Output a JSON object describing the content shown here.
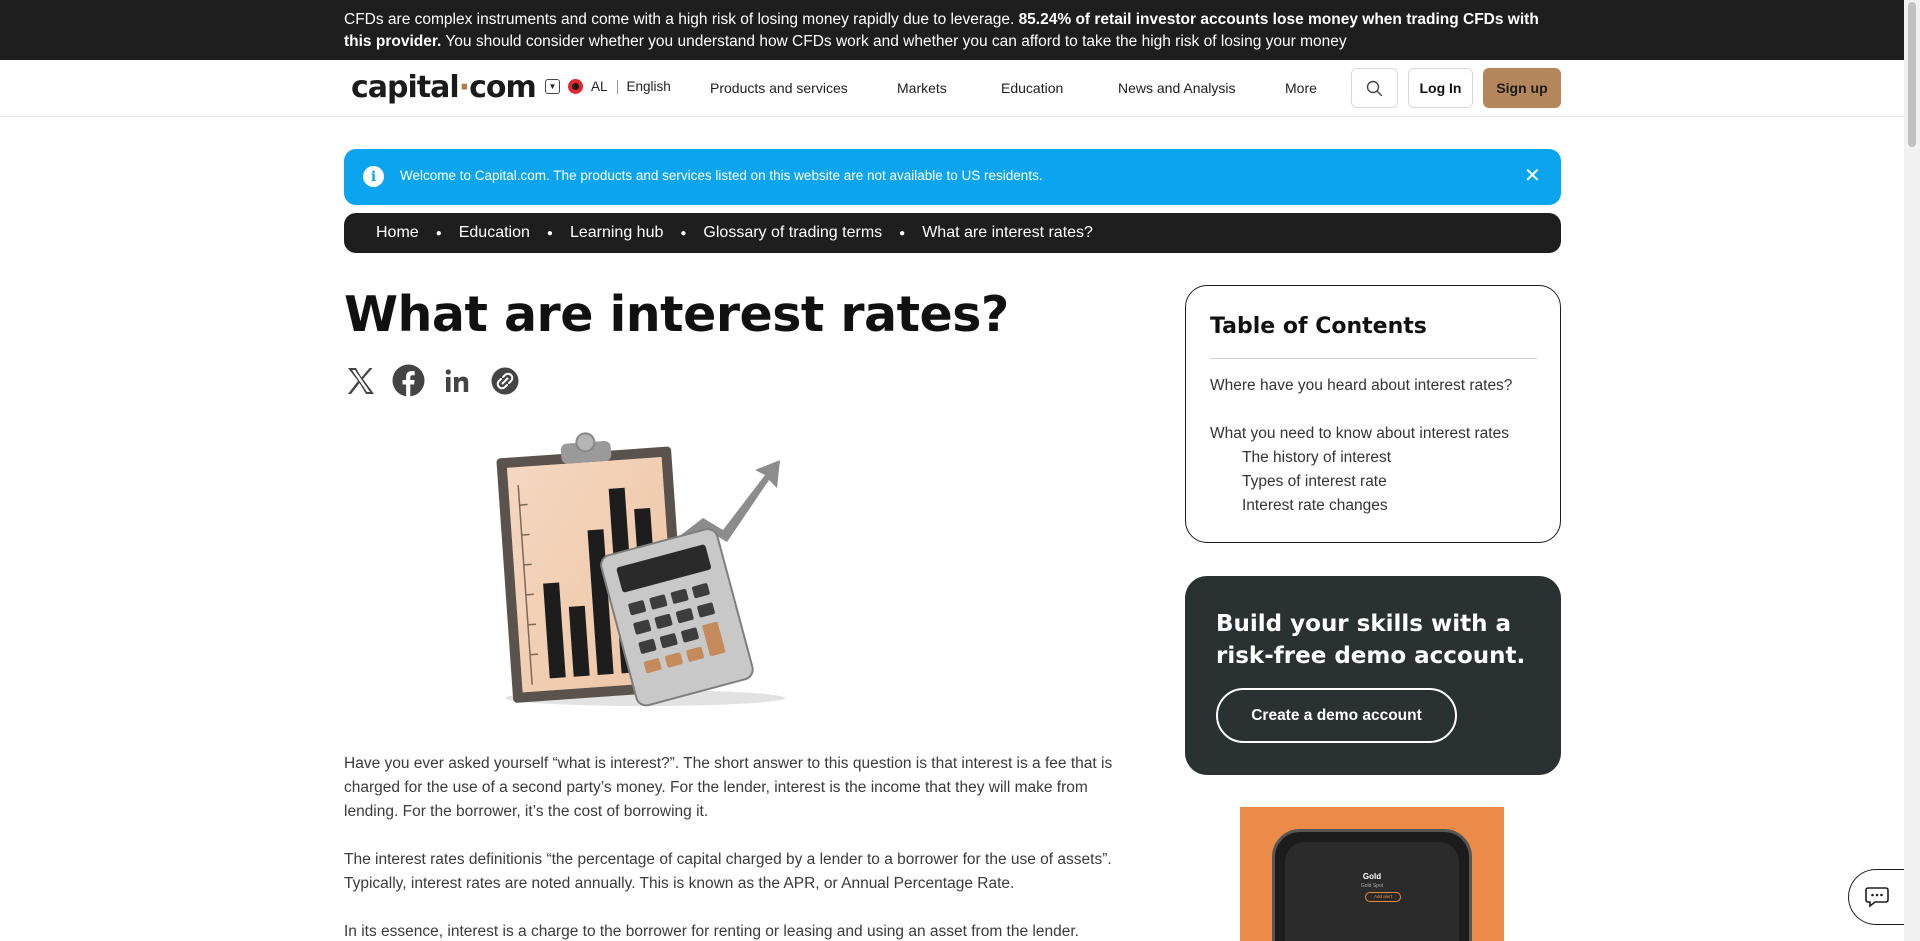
{
  "risk_warning": {
    "lead": "CFDs are complex instruments and come with a high risk of losing money rapidly due to leverage. ",
    "bold": "85.24% of retail investor accounts lose money when trading CFDs with this provider.",
    "tail": " You should consider whether you understand how CFDs work and whether you can afford to take the high risk of losing your money"
  },
  "header": {
    "logo_main": "capital",
    "logo_dot": "·",
    "logo_tld": "com",
    "region_code": "AL",
    "language": "English",
    "nav": [
      "Products and services",
      "Markets",
      "Education",
      "News and Analysis",
      "More"
    ],
    "login_label": "Log In",
    "signup_label": "Sign up"
  },
  "welcome_banner": {
    "info_glyph": "i",
    "message": "Welcome to Capital.com. The products and services listed on this website are not available to US residents.",
    "close_glyph": "✕"
  },
  "breadcrumb": [
    "Home",
    "Education",
    "Learning hub",
    "Glossary of trading terms",
    "What are interest rates?"
  ],
  "article": {
    "title": "What are interest rates?",
    "share_icons": [
      "x-icon",
      "facebook-icon",
      "linkedin-icon",
      "copy-link-icon"
    ],
    "paragraphs": [
      "Have you ever asked yourself “what is interest?”. The short answer to this question is that interest is a fee that is charged for the use of a second party’s money. For the lender, interest is the income that they will make from lending. For the borrower, it’s the cost of borrowing it.",
      "The interest rates definitionis “the percentage of capital charged by a lender to a borrower for the use of assets”. Typically, interest rates are noted annually. This is known as the APR, or Annual Percentage Rate.",
      "In its essence, interest is a charge to the borrower for renting or leasing and using an asset from the lender."
    ]
  },
  "toc": {
    "title": "Table of Contents",
    "items": [
      {
        "label": "Where have you heard about interest rates?",
        "level": 1
      },
      {
        "label": "What you need to know about interest rates",
        "level": 1
      },
      {
        "label": "The history of interest",
        "level": 2
      },
      {
        "label": "Types of interest rate",
        "level": 2
      },
      {
        "label": "Interest rate changes",
        "level": 2
      }
    ]
  },
  "demo_card": {
    "heading": "Build your skills with a risk-free demo account.",
    "cta": "Create a demo account"
  },
  "app_promo": {
    "instrument": "Gold",
    "sub": "Gold Spot",
    "button": "Add alert"
  },
  "colors": {
    "dark": "#1e1e1e",
    "accent_brown": "#b4865c",
    "banner_blue": "#0ba5ef",
    "demo_card": "#2a3133",
    "promo_orange": "#ec8a48"
  }
}
